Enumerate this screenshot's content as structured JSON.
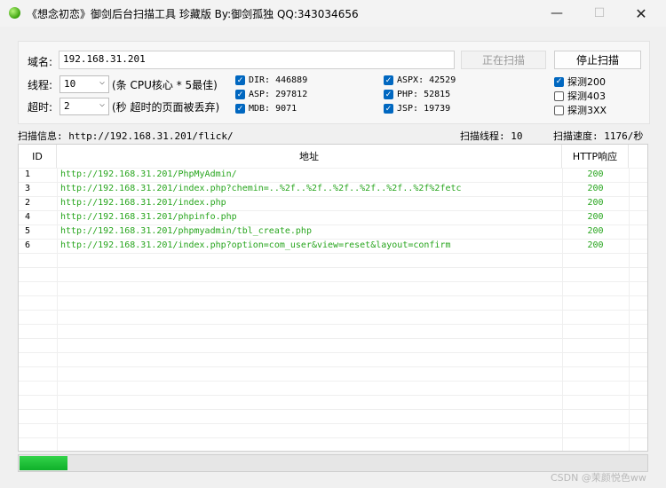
{
  "window": {
    "title": "《想念初恋》御剑后台扫描工具 珍藏版 By:御剑孤独 QQ:343034656",
    "min_glyph": "—",
    "max_glyph": "☐",
    "close_glyph": "✕"
  },
  "form": {
    "domain_label": "域名:",
    "domain_value": "192.168.31.201",
    "scanning_button": "正在扫描",
    "stop_button": "停止扫描",
    "threads_label": "线程:",
    "threads_value": "10",
    "threads_hint": "(条 CPU核心 * 5最佳)",
    "timeout_label": "超时:",
    "timeout_value": "2",
    "timeout_hint": "(秒 超时的页面被丢弃)"
  },
  "dictionaries": [
    {
      "label": "DIR: 446889",
      "checked": true
    },
    {
      "label": "ASP: 297812",
      "checked": true
    },
    {
      "label": "MDB: 9071",
      "checked": true
    },
    {
      "label": "ASPX: 42529",
      "checked": true
    },
    {
      "label": "PHP: 52815",
      "checked": true
    },
    {
      "label": "JSP: 19739",
      "checked": true
    }
  ],
  "detect_options": [
    {
      "label": "探测200",
      "checked": true
    },
    {
      "label": "探测403",
      "checked": false
    },
    {
      "label": "探测3XX",
      "checked": false
    }
  ],
  "status": {
    "scan_info": "扫描信息: http://192.168.31.201/flick/",
    "scan_threads": "扫描线程: 10",
    "scan_speed": "扫描速度: 1176/秒"
  },
  "table": {
    "headers": {
      "id": "ID",
      "url": "地址",
      "http": "HTTP响应"
    },
    "rows": [
      {
        "id": "1",
        "url": "http://192.168.31.201/PhpMyAdmin/",
        "code": "200"
      },
      {
        "id": "3",
        "url": "http://192.168.31.201/index.php?chemin=..%2f..%2f..%2f..%2f..%2f..%2f%2fetc",
        "code": "200"
      },
      {
        "id": "2",
        "url": "http://192.168.31.201/index.php",
        "code": "200"
      },
      {
        "id": "4",
        "url": "http://192.168.31.201/phpinfo.php",
        "code": "200"
      },
      {
        "id": "5",
        "url": "http://192.168.31.201/phpmyadmin/tbl_create.php",
        "code": "200"
      },
      {
        "id": "6",
        "url": "http://192.168.31.201/index.php?option=com_user&view=reset&layout=confirm",
        "code": "200"
      }
    ]
  },
  "progress": {
    "value": 0.077
  },
  "watermark": "CSDN @茉颜悦色ww",
  "colors": {
    "accent": "#0067c0",
    "result_text": "#27a51d",
    "progress": "#1fbf36"
  }
}
